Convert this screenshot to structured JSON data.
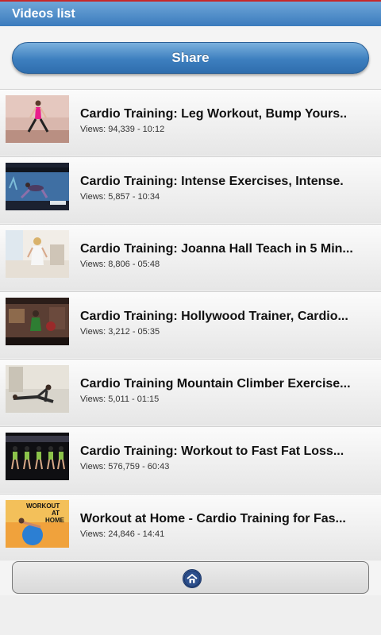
{
  "header": {
    "title": "Videos list"
  },
  "actions": {
    "share_label": "Share"
  },
  "videos": [
    {
      "title": "Cardio Training: Leg Workout, Bump Yours..",
      "meta": "Views: 94,339 - 10:12"
    },
    {
      "title": "Cardio Training: Intense Exercises, Intense.",
      "meta": "Views: 5,857 - 10:34"
    },
    {
      "title": "Cardio Training: Joanna Hall Teach in 5 Min...",
      "meta": "Views: 8,806 - 05:48"
    },
    {
      "title": "Cardio Training: Hollywood Trainer, Cardio...",
      "meta": "Views: 3,212 - 05:35"
    },
    {
      "title": "Cardio Training Mountain Climber Exercise...",
      "meta": "Views: 5,011 - 01:15"
    },
    {
      "title": "Cardio Training: Workout to Fast Fat Loss...",
      "meta": "Views: 576,759 - 60:43"
    },
    {
      "title": "Workout at Home - Cardio Training for Fas...",
      "meta": "Views: 24,846 - 14:41"
    }
  ],
  "thumbnail_text": {
    "workout": "WORKOUT",
    "at": "AT",
    "home": "HOME"
  },
  "icons": {
    "home": "home-icon"
  },
  "colors": {
    "titlebar": "#3b7bbd",
    "share_button": "#3d7fbf",
    "accent_red": "#c62828"
  }
}
